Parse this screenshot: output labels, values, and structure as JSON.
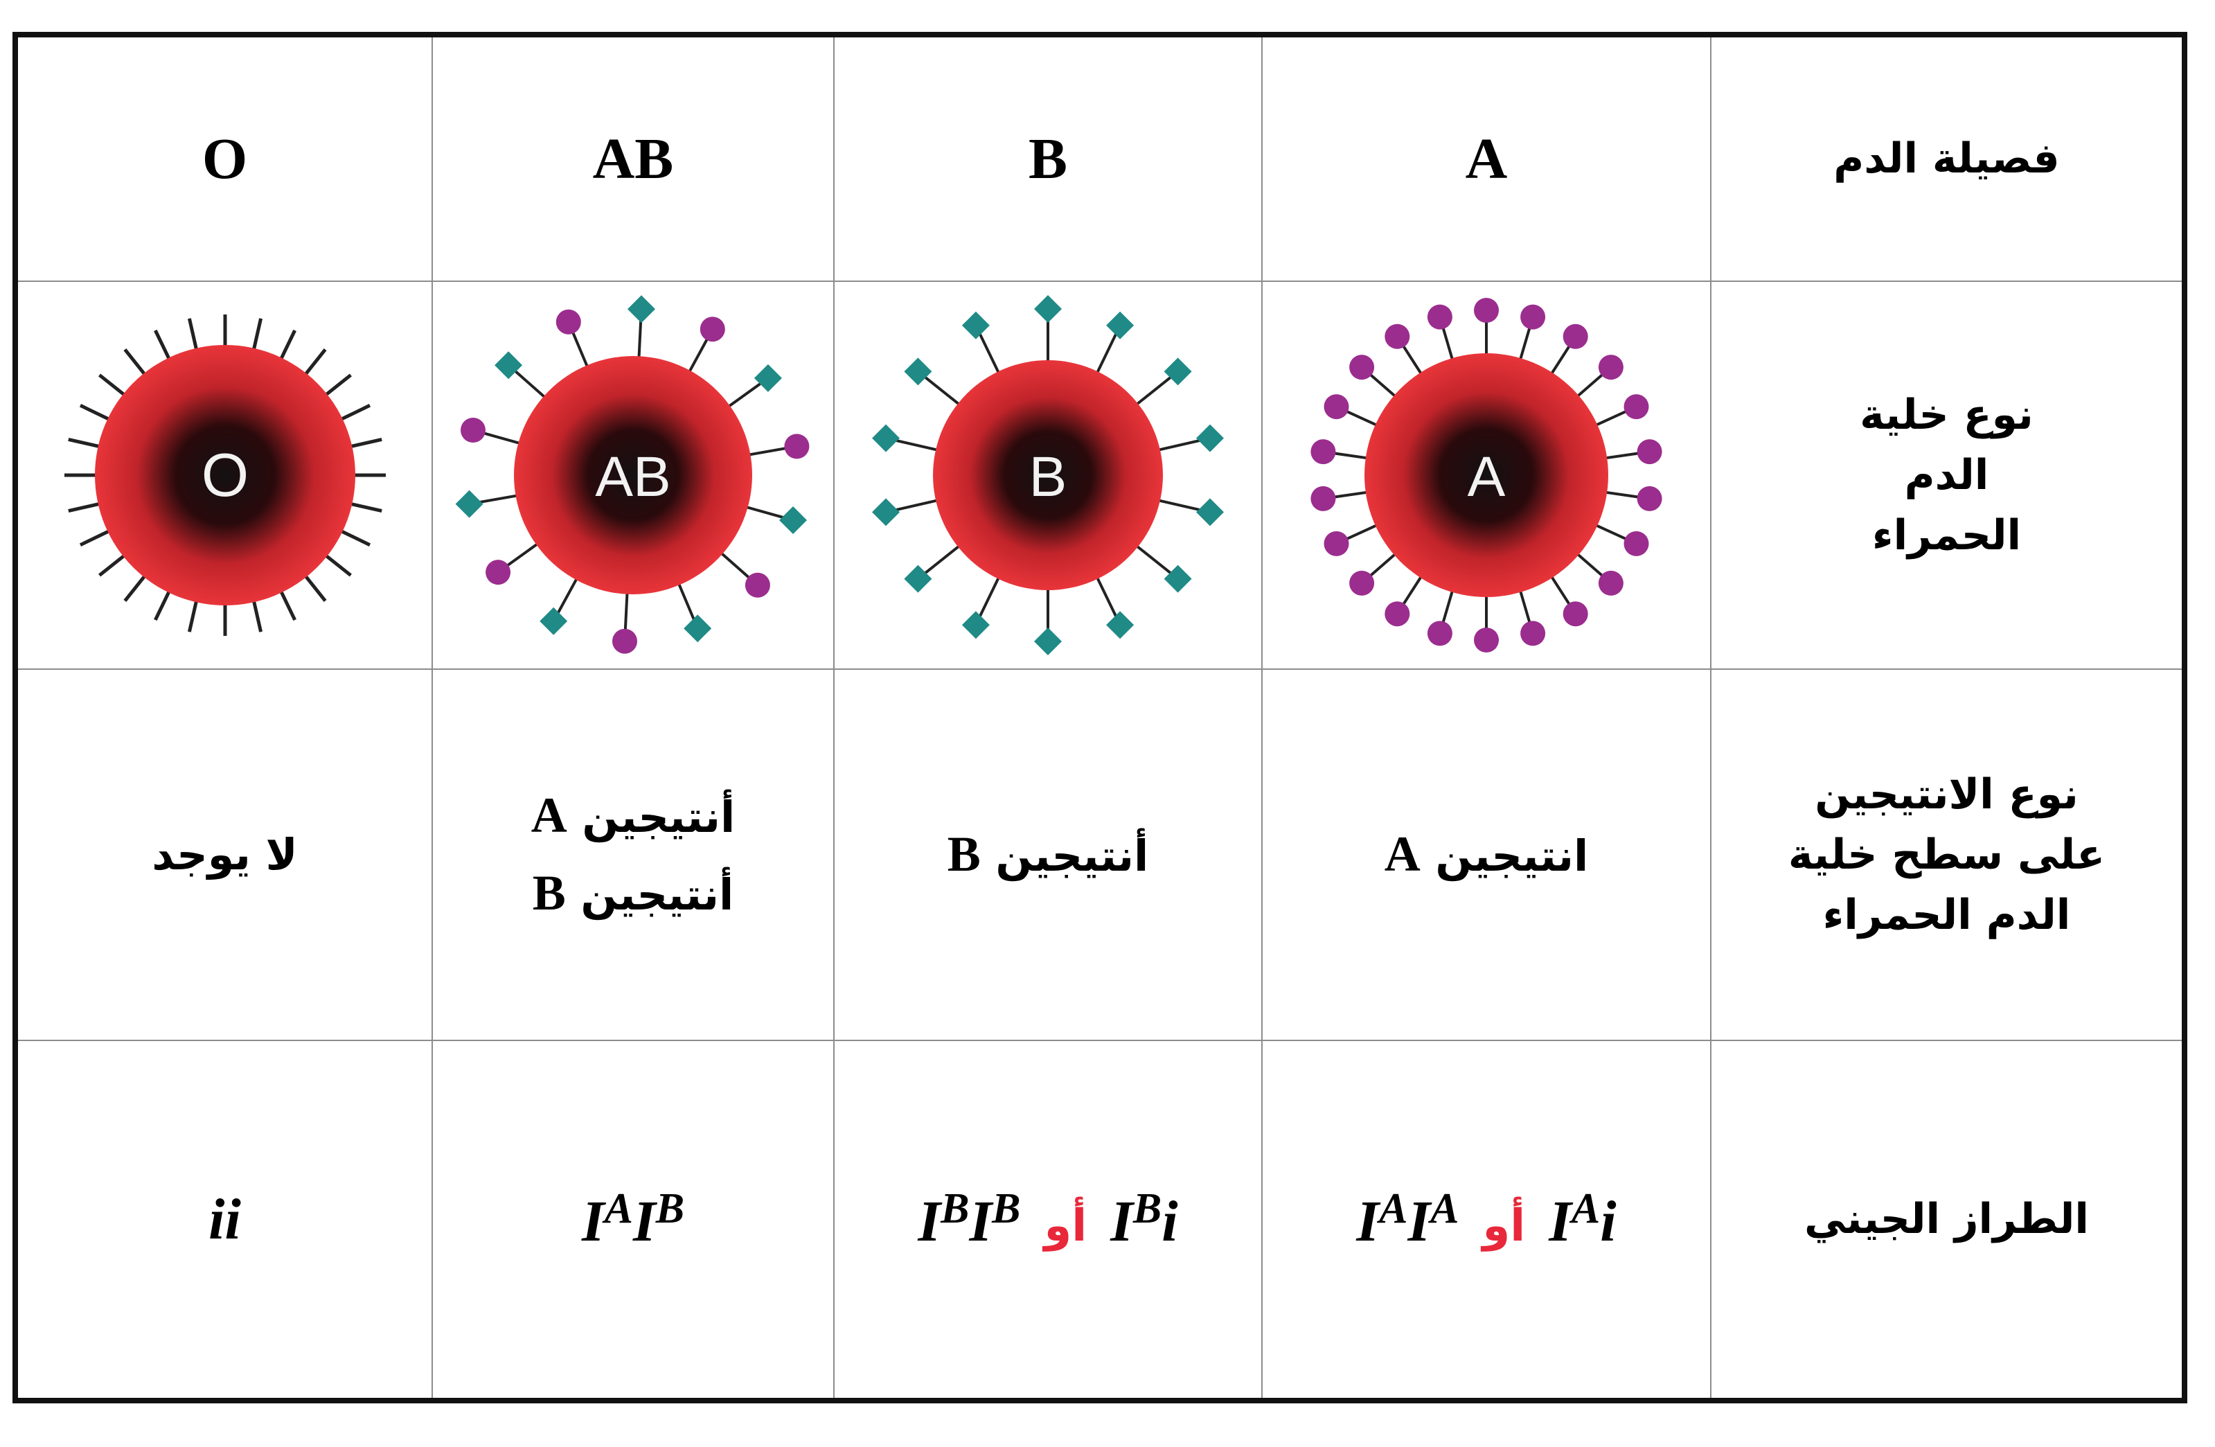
{
  "row_headers": {
    "blood_type": "فصيلة الدم",
    "cell_type": [
      "نوع خلية",
      "الدم",
      "الحمراء"
    ],
    "antigen_type": [
      "نوع الانتيجين",
      "على سطح خلية",
      "الدم الحمراء"
    ],
    "genotype": "الطراز الجيني"
  },
  "columns": [
    {
      "type": "A",
      "cell_label": "A",
      "antigen_lines": [
        {
          "word": "انتيجين",
          "letter": "A"
        }
      ],
      "genotype": {
        "first": {
          "base": "I",
          "sup": "A",
          "tail": "I",
          "tail_sup": "A"
        },
        "or": "أو",
        "second": {
          "base": "I",
          "sup": "A",
          "tail": "i",
          "tail_sup": ""
        }
      },
      "marker_color": "#9b2d8e"
    },
    {
      "type": "B",
      "cell_label": "B",
      "antigen_lines": [
        {
          "word": "أنتيجين",
          "letter": "B"
        }
      ],
      "genotype": {
        "first": {
          "base": "I",
          "sup": "B",
          "tail": "I",
          "tail_sup": "B"
        },
        "or": "أو",
        "second": {
          "base": "I",
          "sup": "B",
          "tail": "i",
          "tail_sup": ""
        }
      },
      "marker_color": "#1f8a86"
    },
    {
      "type": "AB",
      "cell_label": "AB",
      "antigen_lines": [
        {
          "word": "أنتيجين",
          "letter": "A"
        },
        {
          "word": "أنتيجين",
          "letter": "B"
        }
      ],
      "genotype": {
        "single": {
          "base": "I",
          "sup": "A",
          "tail": "I",
          "tail_sup": "B"
        }
      },
      "marker_color": "#9b2d8e"
    },
    {
      "type": "O",
      "cell_label": "O",
      "antigen_text": "لا يوجد",
      "genotype": {
        "plain": "ii"
      },
      "marker_color": "#111111"
    }
  ],
  "colors": {
    "cell_outer": "#e8353a",
    "cell_core": "#141012",
    "antigen_a": "#9b2d8e",
    "antigen_b": "#1f8a86",
    "or_text": "#e8283a",
    "grid": "#8c8c8c",
    "frame": "#111111"
  }
}
